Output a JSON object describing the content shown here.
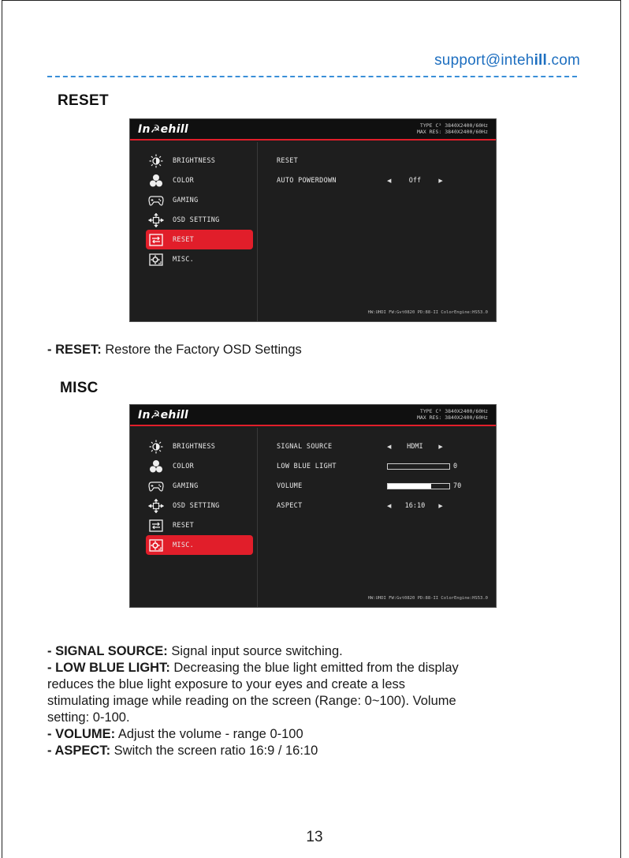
{
  "header": {
    "support_prefix": "support@inteh",
    "support_bold": "ill",
    "support_suffix": ".com"
  },
  "sections": {
    "reset_title": "RESET",
    "misc_title": "MISC"
  },
  "osd_common": {
    "logo": "In☭ehill",
    "spec_line1": "TYPE C²  3840X2400/60Hz",
    "spec_line2": "MAX RES: 3840X2400/60Hz",
    "firmware": "HW:UHDI FW:Gvt0820 PD:88-II ColorEngine:HS53.0",
    "menu": [
      "BRIGHTNESS",
      "COLOR",
      "GAMING",
      "OSD SETTING",
      "RESET",
      "MISC."
    ]
  },
  "osd_reset": {
    "active_menu": "RESET",
    "options": [
      {
        "label": "RESET"
      },
      {
        "label": "AUTO POWERDOWN",
        "value": "Off",
        "arrow_left": "◀",
        "arrow_right": "▶"
      }
    ]
  },
  "osd_misc": {
    "active_menu": "MISC.",
    "options": [
      {
        "label": "SIGNAL SOURCE",
        "value": "HDMI",
        "arrow_left": "◀",
        "arrow_right": "▶"
      },
      {
        "label": "LOW BLUE LIGHT",
        "level": 0,
        "number": "0"
      },
      {
        "label": "VOLUME",
        "level": 70,
        "number": "70"
      },
      {
        "label": "ASPECT",
        "value": "16:10",
        "arrow_left": "◀",
        "arrow_right": "▶"
      }
    ]
  },
  "descriptions": {
    "reset": {
      "key": "- RESET:",
      "text": " Restore the Factory OSD Settings"
    },
    "signal": {
      "key": "- SIGNAL SOURCE:",
      "text": " Signal input source switching."
    },
    "lbl": {
      "key": "- LOW BLUE LIGHT:",
      "text": " Decreasing the blue light emitted from the display"
    },
    "lbl2": "reduces the blue light exposure to your eyes and create a less",
    "lbl3": "stimulating image while reading on the screen (Range: 0~100). Volume",
    "lbl4": "setting: 0-100.",
    "volume": {
      "key": "- VOLUME:",
      "text": " Adjust the volume - range 0-100"
    },
    "aspect": {
      "key": "- ASPECT:",
      "text": " Switch the screen ratio 16:9 / 16:10"
    }
  },
  "footer": {
    "page_number": "13"
  },
  "colors": {
    "accent_red": "#e11e2a",
    "link_blue": "#1e6fc0",
    "osd_bg": "#1e1e1e"
  },
  "icons": [
    "brightness-icon",
    "color-icon",
    "gaming-icon",
    "osd-setting-icon",
    "reset-icon",
    "misc-icon"
  ]
}
